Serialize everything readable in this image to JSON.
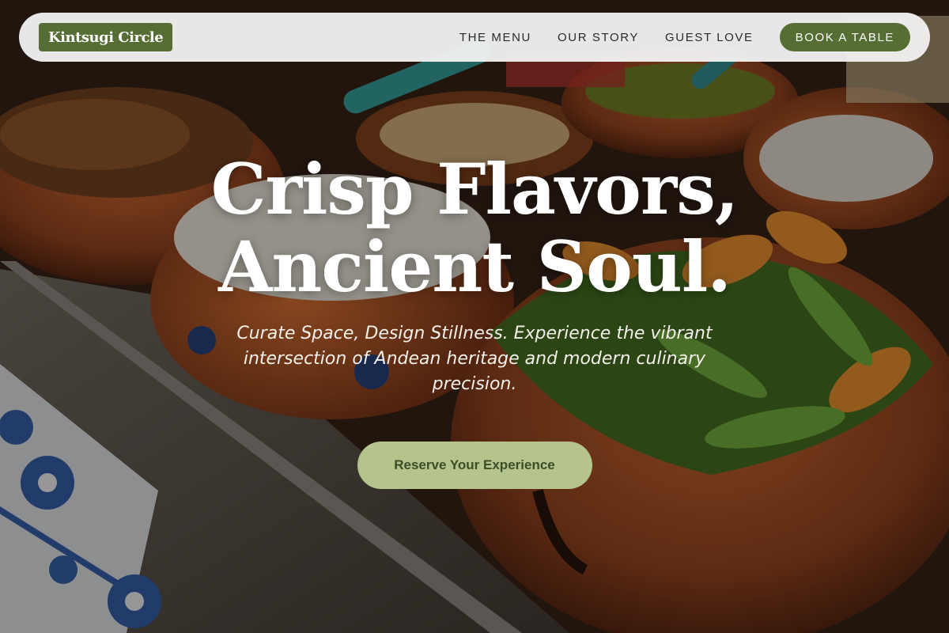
{
  "brand": {
    "name": "Kintsugi Circle"
  },
  "nav": {
    "links": [
      "THE MENU",
      "OUR STORY",
      "GUEST LOVE"
    ],
    "cta": "BOOK A TABLE"
  },
  "hero": {
    "title_line1": "Crisp Flavors,",
    "title_line2": "Ancient Soul.",
    "subtitle": "Curate Space, Design Stillness. Experience the vibrant intersection of Andean heritage and modern culinary precision.",
    "cta": "Reserve Your Experience"
  },
  "colors": {
    "brand_green": "#566d34",
    "cta_sage": "#b4c48c",
    "cta_text": "#3c4d26",
    "nav_bg": "#f0f0f0"
  }
}
